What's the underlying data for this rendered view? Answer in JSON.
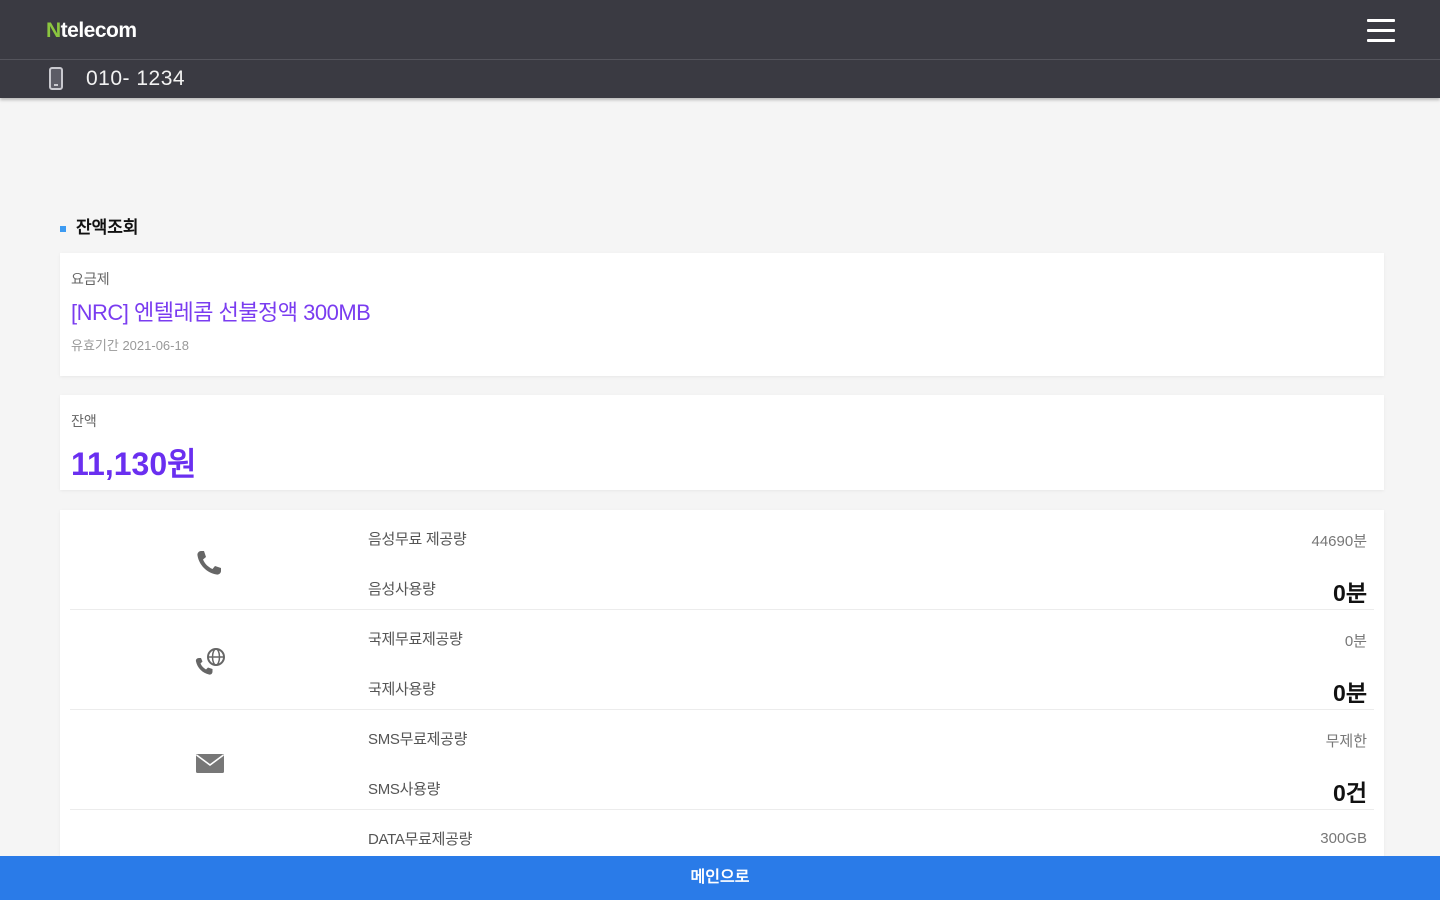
{
  "header": {
    "logo_n": "N",
    "logo_rest": "telecom",
    "menu_icon": "hamburger-menu-icon",
    "phone_icon": "mobile-phone-icon",
    "phone_number": "010- 1234"
  },
  "section": {
    "title": "잔액조회"
  },
  "plan": {
    "label": "요금제",
    "name": "[NRC] 엔텔레콤 선불정액 300MB",
    "validity": "유효기간 2021-06-18"
  },
  "balance": {
    "label": "잔액",
    "amount": "11,130원"
  },
  "usage": [
    {
      "icon": "phone-call-icon",
      "free_label": "음성무료 제공량",
      "free_value": "44690분",
      "used_label": "음성사용량",
      "used_value": "0분"
    },
    {
      "icon": "international-call-icon",
      "free_label": "국제무료제공량",
      "free_value": "0분",
      "used_label": "국제사용량",
      "used_value": "0분"
    },
    {
      "icon": "envelope-icon",
      "free_label": "SMS무료제공량",
      "free_value": "무제한",
      "used_label": "SMS사용량",
      "used_value": "0건"
    },
    {
      "icon": "data-arrows-icon",
      "free_label": "DATA무료제공량",
      "free_value": "300GB",
      "used_label": "",
      "used_value": ""
    }
  ],
  "footer": {
    "button_label": "메인으로"
  },
  "colors": {
    "header_bg": "#3a3a42",
    "logo_accent": "#8bc53f",
    "plan_name": "#7a3cf0",
    "balance": "#6a2ff0",
    "section_dot": "#3d9bf2",
    "button_bg": "#2a7be8"
  }
}
